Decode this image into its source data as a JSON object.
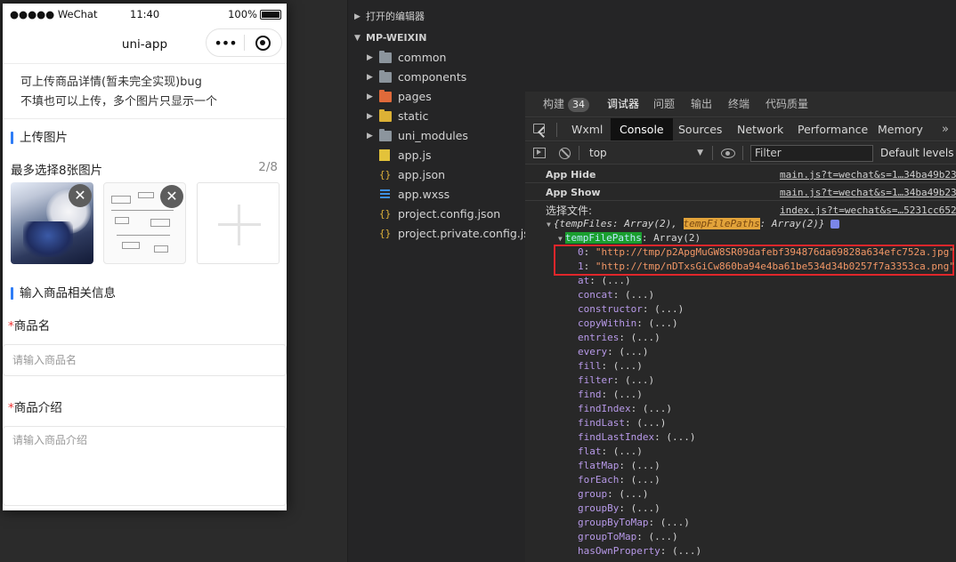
{
  "simulator": {
    "status": {
      "signal": "●●●●● WeChat",
      "time": "11:40",
      "battery": "100%"
    },
    "nav": {
      "title": "uni-app",
      "more": "•••"
    },
    "notice": [
      "可上传商品详情(暂未完全实现)bug",
      "不填也可以上传，多个图片只显示一个"
    ],
    "upload": {
      "section_title": "上传图片",
      "picker_label": "最多选择8张图片",
      "count": "2/8",
      "delete_glyph": "✕"
    },
    "info": {
      "section_title": "输入商品相关信息",
      "name_required": "*",
      "name_label": "商品名",
      "name_placeholder": "请输入商品名",
      "desc_required": "*",
      "desc_label": "商品介绍",
      "desc_placeholder": "请输入商品介绍"
    }
  },
  "explorer": {
    "open_editors": "打开的编辑器",
    "project": "MP-WEIXIN",
    "items": [
      {
        "name": "common",
        "icon": "folder-grey-icon",
        "folder": true
      },
      {
        "name": "components",
        "icon": "folder-grey-icon",
        "folder": true
      },
      {
        "name": "pages",
        "icon": "folder-red-icon",
        "folder": true
      },
      {
        "name": "static",
        "icon": "folder-yellow-icon",
        "folder": true
      },
      {
        "name": "uni_modules",
        "icon": "folder-grey-icon",
        "folder": true
      },
      {
        "name": "app.js",
        "icon": "js-file-icon",
        "folder": false
      },
      {
        "name": "app.json",
        "icon": "json-file-icon",
        "folder": false
      },
      {
        "name": "app.wxss",
        "icon": "wxss-file-icon",
        "folder": false
      },
      {
        "name": "project.config.json",
        "icon": "json-file-icon",
        "folder": false
      },
      {
        "name": "project.private.config.js...",
        "icon": "json-file-icon",
        "folder": false
      }
    ]
  },
  "devtools": {
    "top_tabs": [
      {
        "label": "构建",
        "badge": "34"
      },
      {
        "label": "调试器",
        "active": true
      },
      {
        "label": "问题"
      },
      {
        "label": "输出"
      },
      {
        "label": "终端"
      },
      {
        "label": "代码质量"
      }
    ],
    "panel_tabs": [
      "Wxml",
      "Console",
      "Sources",
      "Network",
      "Performance",
      "Memory"
    ],
    "active_panel": "Console",
    "more_glyph": "»",
    "toolbar": {
      "context": "top",
      "filter_placeholder": "Filter",
      "levels": "Default levels ▼"
    },
    "console": {
      "logs": [
        {
          "msg": "App Hide",
          "src": "main.js?t=wechat&s=1…34ba49b23"
        },
        {
          "msg": "App Show",
          "src": "main.js?t=wechat&s=1…34ba49b23"
        }
      ],
      "select_label": "选择文件:",
      "select_src": "index.js?t=wechat&s=…5231cc652",
      "obj_summary_1": "{tempFiles: Array(2), ",
      "obj_key_highlight": "tempFilePaths",
      "obj_summary_2": ": Array(2)}",
      "expanded_key": "tempFilePaths",
      "expanded_type": ": Array(2)",
      "entries": [
        {
          "index": "0",
          "value": "\"http://tmp/p2ApgMuGW8SR09dafebf394876da69828a634efc752a.jpg\""
        },
        {
          "index": "1",
          "value": "\"http://tmp/nDTxsGiCw860ba94e4ba61be534d34b0257f7a3353ca.png\""
        }
      ],
      "methods": [
        "at",
        "concat",
        "constructor",
        "copyWithin",
        "entries",
        "every",
        "fill",
        "filter",
        "find",
        "findIndex",
        "findLast",
        "findLastIndex",
        "flat",
        "flatMap",
        "forEach",
        "group",
        "groupBy",
        "groupByToMap",
        "groupToMap",
        "hasOwnProperty"
      ],
      "method_suffix": ": (...)"
    }
  },
  "colors": {
    "accent_blue": "#2e7cf6",
    "required_red": "#e33333",
    "highlight_box": "#e0262b"
  }
}
